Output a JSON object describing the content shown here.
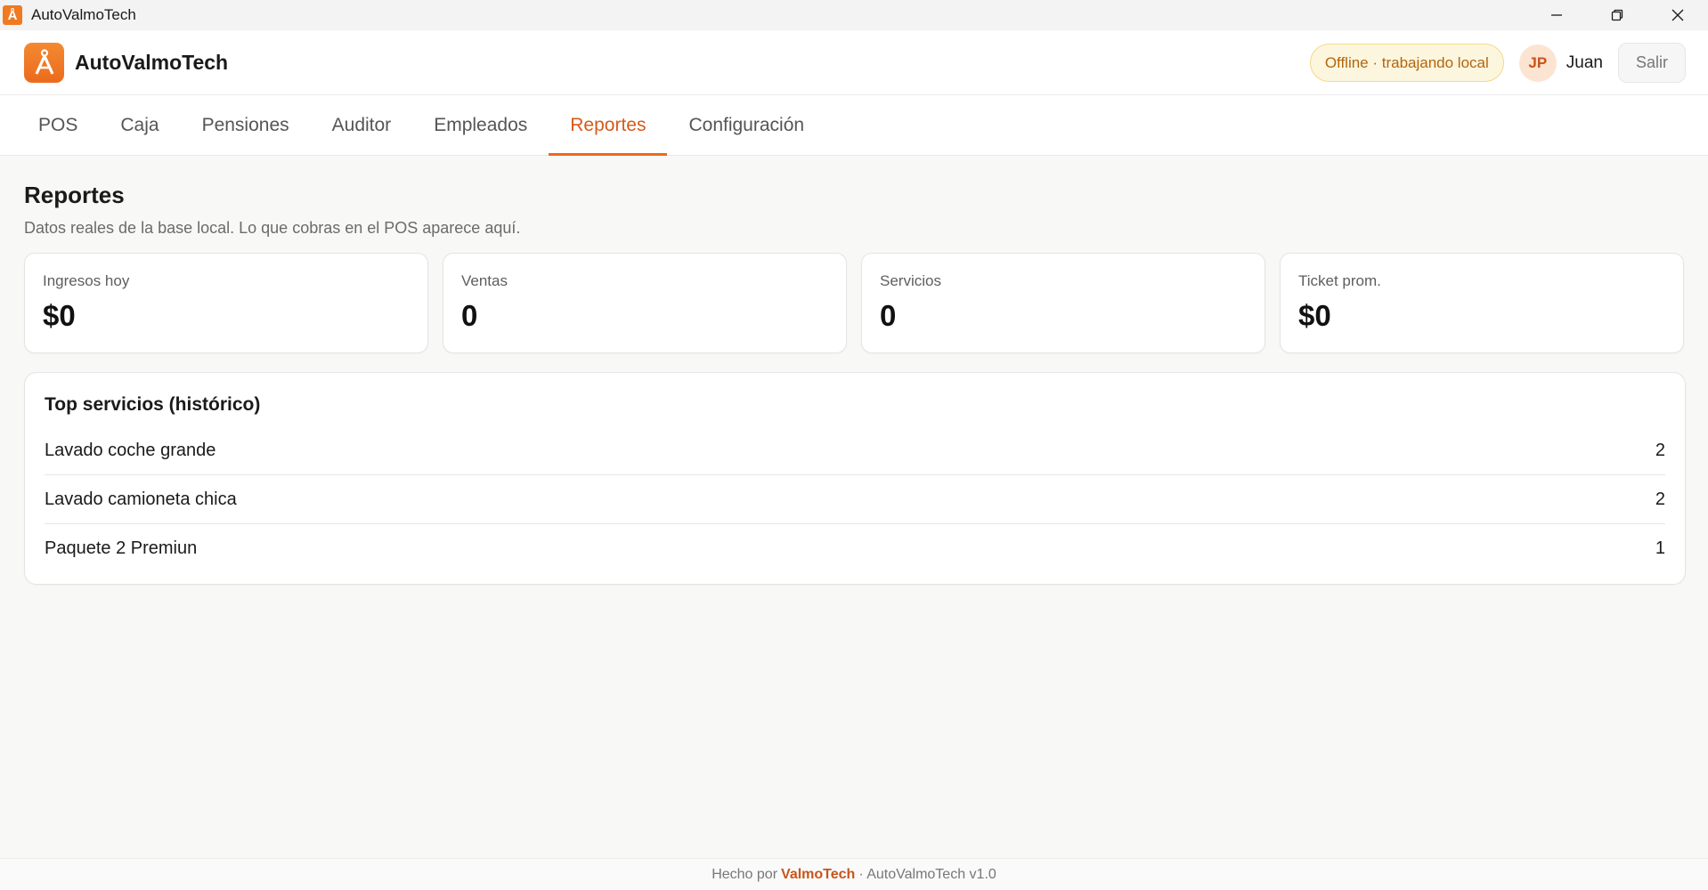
{
  "window": {
    "title": "AutoValmoTech",
    "icon": "app-logo-icon"
  },
  "header": {
    "brand": "AutoValmoTech",
    "status_badge": "Offline · trabajando local",
    "user_initials": "JP",
    "user_name": "Juan",
    "logout_label": "Salir"
  },
  "tabs": [
    {
      "label": "POS",
      "active": false
    },
    {
      "label": "Caja",
      "active": false
    },
    {
      "label": "Pensiones",
      "active": false
    },
    {
      "label": "Auditor",
      "active": false
    },
    {
      "label": "Empleados",
      "active": false
    },
    {
      "label": "Reportes",
      "active": true
    },
    {
      "label": "Configuración",
      "active": false
    }
  ],
  "page": {
    "title": "Reportes",
    "subtitle": "Datos reales de la base local. Lo que cobras en el POS aparece aquí."
  },
  "stats": [
    {
      "label": "Ingresos hoy",
      "value": "$0"
    },
    {
      "label": "Ventas",
      "value": "0"
    },
    {
      "label": "Servicios",
      "value": "0"
    },
    {
      "label": "Ticket prom.",
      "value": "$0"
    }
  ],
  "top_services": {
    "title": "Top servicios (histórico)",
    "items": [
      {
        "name": "Lavado coche grande",
        "count": "2"
      },
      {
        "name": "Lavado camioneta chica",
        "count": "2"
      },
      {
        "name": "Paquete 2 Premiun",
        "count": "1"
      }
    ]
  },
  "footer": {
    "prefix": "Hecho por",
    "brand": "ValmoTech",
    "suffix": "· AutoValmoTech v1.0"
  },
  "colors": {
    "accent": "#ec6a1c",
    "accent_text": "#d65a1a",
    "offline_bg": "#fdf6de",
    "offline_text": "#b2650e"
  }
}
